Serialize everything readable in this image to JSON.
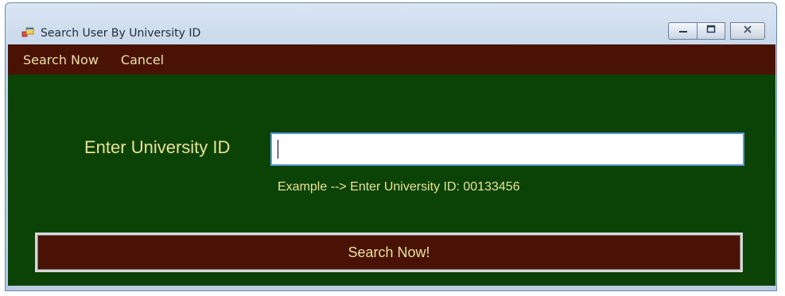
{
  "window": {
    "title": "Search User By University ID"
  },
  "menu": {
    "items": [
      "Search Now",
      "Cancel"
    ]
  },
  "form": {
    "label": "Enter University ID",
    "input_value": "",
    "example": "Example --> Enter University ID:  00133456",
    "submit_label": "Search Now!"
  },
  "colors": {
    "menu_bg": "#4a1105",
    "client_bg": "#0b4307",
    "text_yellow": "#e9e38f"
  }
}
